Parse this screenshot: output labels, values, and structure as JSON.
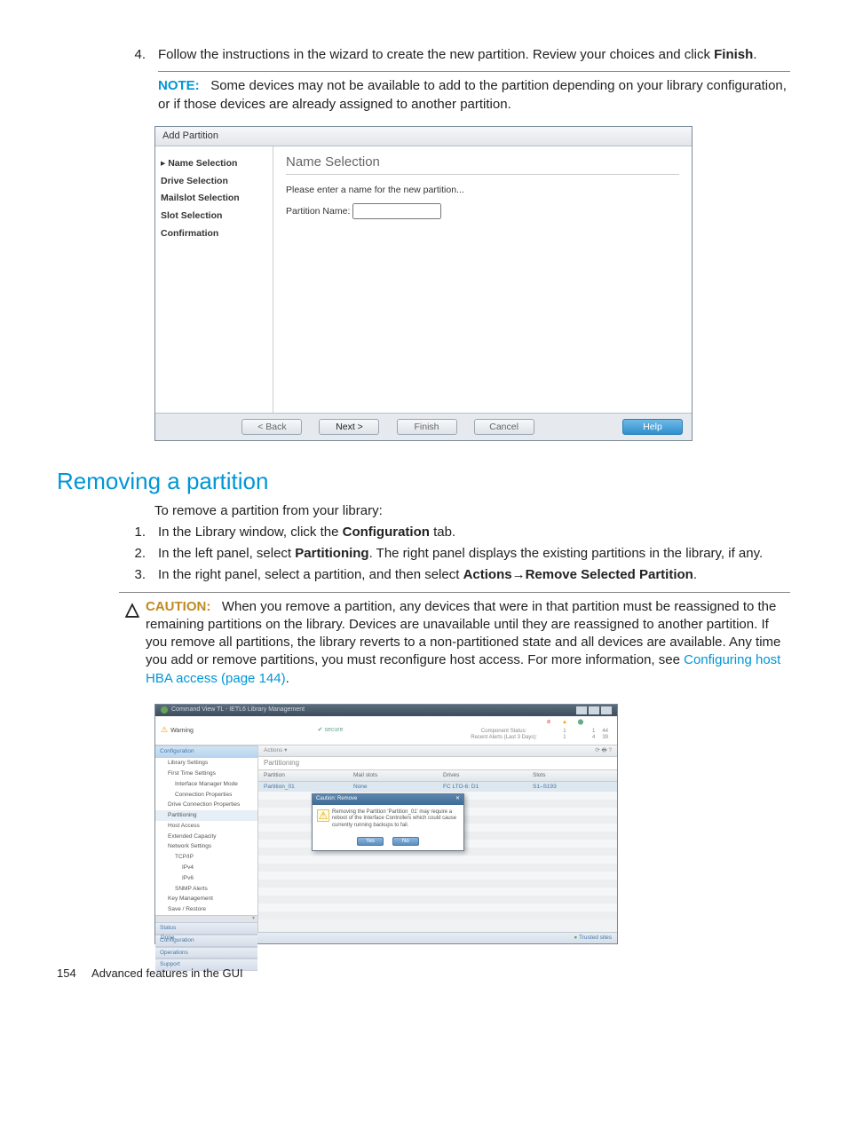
{
  "instr4": {
    "num": "4.",
    "text_a": "Follow the instructions in the wizard to create the new partition. Review your choices and click ",
    "finish": "Finish",
    "period": "."
  },
  "note": {
    "label": "NOTE:",
    "text": "Some devices may not be available to add to the partition depending on your library configuration, or if those devices are already assigned to another partition."
  },
  "wizard": {
    "title": "Add Partition",
    "steps": {
      "name": "Name Selection",
      "drive": "Drive Selection",
      "mailslot": "Mailslot Selection",
      "slot": "Slot Selection",
      "confirm": "Confirmation"
    },
    "panel_title": "Name Selection",
    "hint": "Please enter a name for the new partition...",
    "field_label": "Partition Name:",
    "field_value": "",
    "buttons": {
      "back": "< Back",
      "next": "Next >",
      "finish": "Finish",
      "cancel": "Cancel",
      "help": "Help"
    }
  },
  "section_heading": "Removing a partition",
  "remove_intro": "To remove a partition from your library:",
  "remove_steps": {
    "s1": {
      "num": "1.",
      "a": "In the Library window, click the ",
      "b": "Configuration",
      "c": " tab."
    },
    "s2": {
      "num": "2.",
      "a": "In the left panel, select ",
      "b": "Partitioning",
      "c": ". The right panel displays the existing partitions in the library, if any."
    },
    "s3": {
      "num": "3.",
      "a": "In the right panel, select a partition, and then select ",
      "b": "Actions",
      "arrow": "→",
      "d": "Remove Selected Partition",
      "e": "."
    }
  },
  "caution": {
    "icon": "△",
    "label": "CAUTION:",
    "text": "When you remove a partition, any devices that were in that partition must be reassigned to the remaining partitions on the library. Devices are unavailable until they are reassigned to another partition. If you remove all partitions, the library reverts to a non-partitioned state and all devices are available. Any time you add or remove partitions, you must reconfigure host access. For more information, see ",
    "link": "Configuring host HBA access (page 144)",
    "period": "."
  },
  "mgmt": {
    "titlebar": "Command View TL - IETL6 Library Management",
    "warning": "Warning",
    "secure": "secure",
    "status_table": {
      "r1": "Component Status:",
      "r2": "Recent Alerts (Last 3 Days):",
      "v1a": "1",
      "v1b": "1",
      "v1c": "44",
      "v2a": "1",
      "v2b": "4",
      "v2c": "39"
    },
    "left": {
      "configuration": "Configuration",
      "lib_settings": "Library Settings",
      "first_time": "First Time Settings",
      "iface_mgr": "Interface Manager Mode",
      "conn_props": "Connection Properties",
      "drive_conn": "Drive Connection Properties",
      "partitioning": "Partitioning",
      "host_access": "Host Access",
      "ext_cap": "Extended Capacity",
      "net_settings": "Network Settings",
      "tcpip": "TCP/IP",
      "ipv4": "IPv4",
      "ipv6": "IPv6",
      "snmp": "SNMP Alerts",
      "keymgmt": "Key Management",
      "save_restore": "Save / Restore",
      "status": "Status",
      "configuration2": "Configuration",
      "operations": "Operations",
      "support": "Support"
    },
    "toolbar": {
      "actions": "Actions ▾",
      "icons": "⟳ 🖶 ?"
    },
    "panel_title": "Partitioning",
    "cols": {
      "partition": "Partition",
      "mailslots": "Mail slots",
      "drives": "Drives",
      "slots": "Slots"
    },
    "row": {
      "partition": "Partition_01",
      "mailslots": "None",
      "drives": "FC LTO-6: D1",
      "slots": "S1–S193"
    },
    "dialog": {
      "title": "Caution: Remove",
      "x": "✕",
      "body": "Removing the Partition 'Partition_01' may require a reboot of the Interface Controllers which could cause currently running backups to fail.",
      "yes": "Yes",
      "no": "No"
    },
    "statusbar": {
      "done": "Done",
      "trusted": "Trusted sites"
    }
  },
  "footer": {
    "page": "154",
    "title": "Advanced features in the GUI"
  }
}
